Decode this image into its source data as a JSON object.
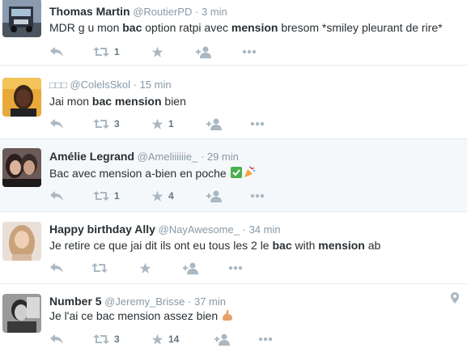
{
  "tweets": [
    {
      "name": "Thomas Martin",
      "handle": "@RoutierPD",
      "sep": "·",
      "time": "3 min",
      "text_parts": [
        "MDR g u mon ",
        "bac",
        " option ratpi avec ",
        "mension",
        " bresom *smiley pleurant de rire*"
      ],
      "retweets": "1",
      "likes": "",
      "avatar": "truck"
    },
    {
      "name": "□□□",
      "handle": "@ColelsSkol",
      "sep": "·",
      "time": "15 min",
      "text_parts": [
        "Jai mon ",
        "bac mension",
        " bien"
      ],
      "retweets": "3",
      "likes": "1",
      "avatar": "man"
    },
    {
      "name": "Amélie Legrand",
      "handle": "@Ameliiiiiie_",
      "sep": "·",
      "time": "29 min",
      "text_parts": [
        "Bac avec mension a-bien en poche "
      ],
      "retweets": "1",
      "likes": "4",
      "avatar": "couple"
    },
    {
      "name": "Happy birthday Ally",
      "handle": "@NayAwesome_",
      "sep": "·",
      "time": "34 min",
      "text_parts": [
        "Je retire ce que jai dit ils ont eu tous les 2 le ",
        "bac",
        " with ",
        "mension",
        " ab"
      ],
      "retweets": "",
      "likes": "",
      "avatar": "woman"
    },
    {
      "name": "Number 5",
      "handle": "@Jeremy_Brisse",
      "sep": "·",
      "time": "37 min",
      "text_parts": [
        "Je l'ai ce bac mension assez bien "
      ],
      "retweets": "3",
      "likes": "14",
      "avatar": "bw"
    }
  ],
  "icons": {
    "reply": "reply-icon",
    "retweet": "retweet-icon",
    "like": "star-icon",
    "follow": "follow-icon",
    "more": "more-icon",
    "checkmark": "check-emoji-icon",
    "party": "party-popper-icon",
    "muscle": "flexed-biceps-icon",
    "location": "location-pin-icon"
  },
  "colors": {
    "icon": "#aab8c2",
    "secondary_text": "#8899a6",
    "highlight_bg": "#f5f8fa",
    "divider": "#e1e8ed"
  }
}
